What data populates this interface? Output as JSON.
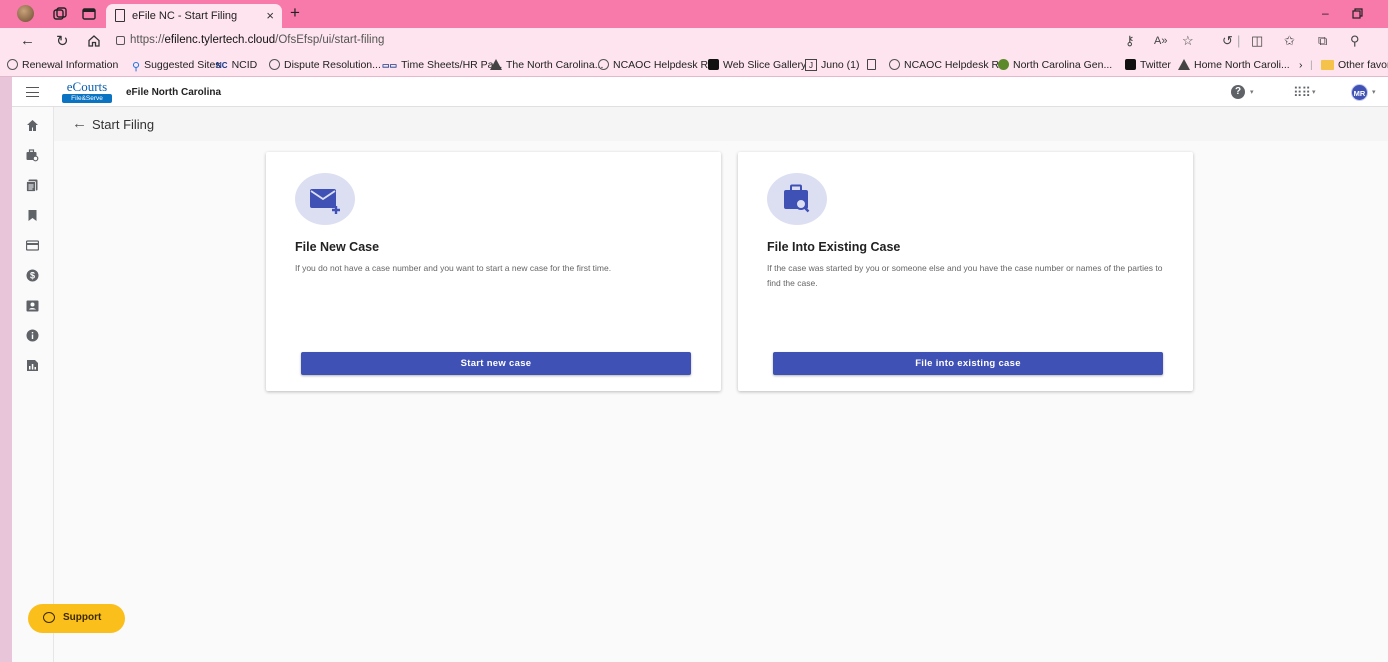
{
  "browser": {
    "tab_title": "eFile NC - Start Filing",
    "tab_close": "×",
    "new_tab": "+",
    "url_prefix": "https://",
    "url_host": "efilenc.tylertech.cloud",
    "url_path": "/OfsEfsp/ui/start-filing",
    "bookmarks": [
      {
        "label": "Renewal Information",
        "icon": "circle-icon"
      },
      {
        "label": "Suggested Sites",
        "icon": "search-icon"
      },
      {
        "label": "NCID",
        "icon": "nc-icon"
      },
      {
        "label": "Dispute Resolution...",
        "icon": "circle-icon"
      },
      {
        "label": "Time Sheets/HR Pa...",
        "icon": "timesheet-icon"
      },
      {
        "label": "The North Carolina...",
        "icon": "triangle-icon"
      },
      {
        "label": "NCAOC Helpdesk R...",
        "icon": "circle-icon"
      },
      {
        "label": "Web Slice Gallery",
        "icon": "web-slice-icon"
      },
      {
        "label": "Juno (1)",
        "icon": "juno-icon"
      },
      {
        "label": "NCAOC Helpdesk R...",
        "icon": "circle-icon"
      },
      {
        "label": "North Carolina Gen...",
        "icon": "nc-gen-icon"
      },
      {
        "label": "Twitter",
        "icon": "x-icon"
      },
      {
        "label": "Home North Caroli...",
        "icon": "triangle-icon"
      },
      {
        "label": "Other favorit",
        "icon": "folder-icon"
      }
    ],
    "nc_badge": "NC",
    "juno_badge": "J"
  },
  "app": {
    "logo_top": "eCourts",
    "logo_bottom": "File&Serve",
    "name": "eFile North Carolina",
    "user_initials": "MR",
    "help_glyph": "?",
    "caret": "▾",
    "sidenav_icons": [
      "home-icon",
      "case-search-icon",
      "filings-icon",
      "bookmark-icon",
      "payment-card-icon",
      "dollar-icon",
      "contacts-icon",
      "info-icon",
      "reports-icon"
    ]
  },
  "page": {
    "back_arrow": "←",
    "title": "Start Filing"
  },
  "cards": [
    {
      "icon": "mail-plus-icon",
      "title": "File New Case",
      "description": "If you do not have a case number and you want to start a new case for the first time.",
      "button": "Start new case"
    },
    {
      "icon": "briefcase-search-icon",
      "title": "File Into Existing Case",
      "description": "If the case was started by you or someone else and you have the case number or names of the parties to find the case.",
      "button": "File into existing case"
    }
  ],
  "support": {
    "label": "Support"
  },
  "colors": {
    "accent": "#3f51b5",
    "support": "#fbbf1b",
    "browser_frame": "#f77aaa"
  }
}
